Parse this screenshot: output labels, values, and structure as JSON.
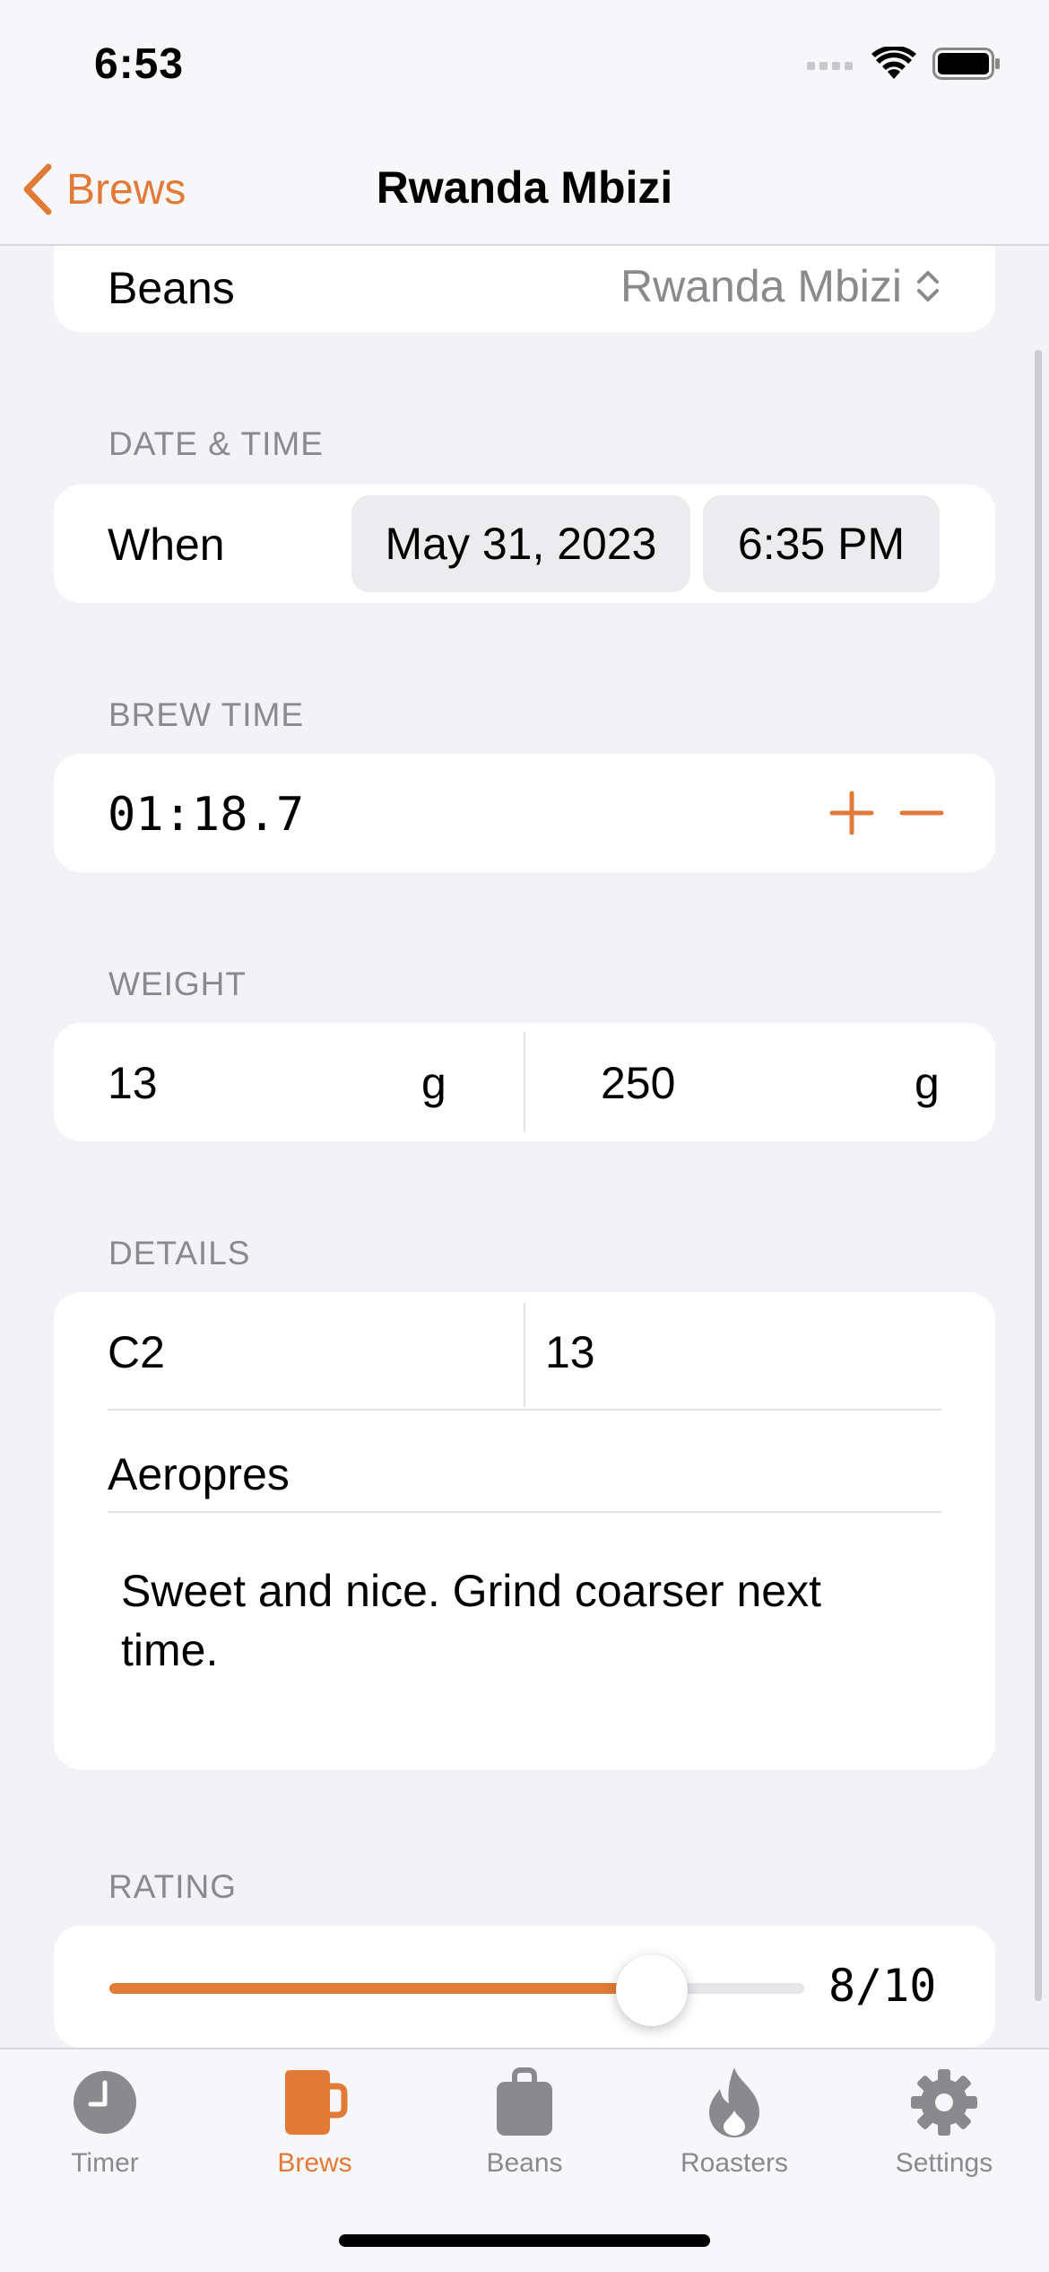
{
  "status": {
    "time": "6:53"
  },
  "nav": {
    "back_label": "Brews",
    "title": "Rwanda Mbizi"
  },
  "beans": {
    "label": "Beans",
    "value": "Rwanda Mbizi"
  },
  "date_time": {
    "header": "DATE & TIME",
    "label": "When",
    "date": "May 31, 2023",
    "time": "6:35 PM"
  },
  "brew_time": {
    "header": "BREW TIME",
    "value": "01:18.7"
  },
  "weight": {
    "header": "WEIGHT",
    "dose": "13",
    "dose_unit": "g",
    "water": "250",
    "water_unit": "g"
  },
  "details": {
    "header": "DETAILS",
    "grinder": "C2",
    "grind_setting": "13",
    "method": "Aeropres",
    "notes_line1": "Sweet and nice. Grind coarser next",
    "notes_line2": "time."
  },
  "rating": {
    "header": "RATING",
    "value": 8,
    "max": 10,
    "display": "8/10"
  },
  "tabs": [
    {
      "label": "Timer",
      "icon": "clock-icon",
      "active": false
    },
    {
      "label": "Brews",
      "icon": "mug-icon",
      "active": true
    },
    {
      "label": "Beans",
      "icon": "bag-icon",
      "active": false
    },
    {
      "label": "Roasters",
      "icon": "flame-icon",
      "active": false
    },
    {
      "label": "Settings",
      "icon": "gear-icon",
      "active": false
    }
  ],
  "colors": {
    "accent": "#e27a37",
    "background": "#f2f2f7",
    "secondary_text": "#8a8a8e",
    "tab_inactive": "#8a8a8e"
  }
}
